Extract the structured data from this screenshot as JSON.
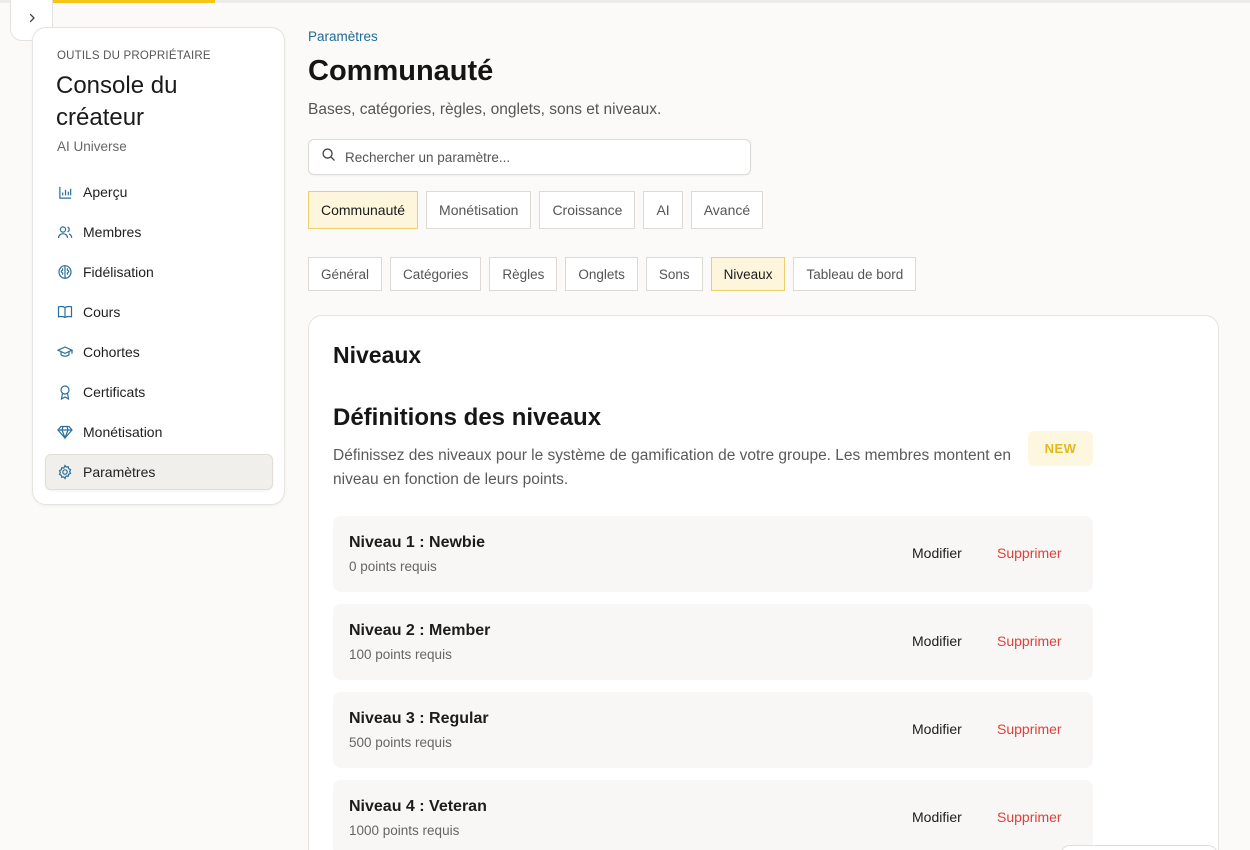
{
  "sidebar": {
    "caption": "OUTILS DU PROPRIÉTAIRE",
    "title": "Console du créateur",
    "subtitle": "AI Universe",
    "items": [
      {
        "label": "Aperçu",
        "icon": "bar-chart-icon"
      },
      {
        "label": "Membres",
        "icon": "users-icon"
      },
      {
        "label": "Fidélisation",
        "icon": "brain-icon"
      },
      {
        "label": "Cours",
        "icon": "book-icon"
      },
      {
        "label": "Cohortes",
        "icon": "graduation-cap-icon"
      },
      {
        "label": "Certificats",
        "icon": "award-icon"
      },
      {
        "label": "Monétisation",
        "icon": "diamond-icon"
      },
      {
        "label": "Paramètres",
        "icon": "gear-icon",
        "active": true
      }
    ]
  },
  "header": {
    "breadcrumb": "Paramètres",
    "title": "Communauté",
    "description": "Bases, catégories, règles, onglets, sons et niveaux."
  },
  "search": {
    "placeholder": "Rechercher un paramètre..."
  },
  "main_tabs": [
    {
      "label": "Communauté",
      "active": true
    },
    {
      "label": "Monétisation"
    },
    {
      "label": "Croissance"
    },
    {
      "label": "AI"
    },
    {
      "label": "Avancé"
    }
  ],
  "sub_tabs": [
    {
      "label": "Général"
    },
    {
      "label": "Catégories"
    },
    {
      "label": "Règles"
    },
    {
      "label": "Onglets"
    },
    {
      "label": "Sons"
    },
    {
      "label": "Niveaux",
      "active": true
    },
    {
      "label": "Tableau de bord"
    }
  ],
  "card": {
    "title": "Niveaux",
    "section_title": "Définitions des niveaux",
    "section_description": "Définissez des niveaux pour le système de gamification de votre groupe. Les membres montent en niveau en fonction de leurs points.",
    "badge": "NEW",
    "edit_label": "Modifier",
    "delete_label": "Supprimer",
    "levels": [
      {
        "name": "Niveau 1 : Newbie",
        "points": "0 points requis"
      },
      {
        "name": "Niveau 2 : Member",
        "points": "100 points requis"
      },
      {
        "name": "Niveau 3 : Regular",
        "points": "500 points requis"
      },
      {
        "name": "Niveau 4 : Veteran",
        "points": "1000 points requis"
      }
    ]
  },
  "colors": {
    "accent": "#f5c518",
    "link": "#1e6b98",
    "danger": "#e0403a",
    "active_tab_bg": "#fdf6dd",
    "active_tab_border": "#ecd06c"
  }
}
